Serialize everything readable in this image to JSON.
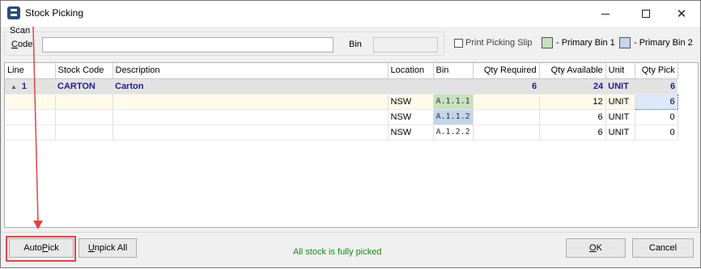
{
  "window": {
    "title": "Stock Picking",
    "controls": [
      "minimize-icon",
      "maximize-icon",
      "close-icon"
    ]
  },
  "scan": {
    "group_label": "Scan",
    "code_label_prefix": "",
    "code_label_accel": "C",
    "code_label_rest": "ode",
    "code_value": "",
    "bin_label": "Bin",
    "bin_value": ""
  },
  "options": {
    "print_picking_slip_label": "Print Picking Slip",
    "print_picking_slip_checked": false,
    "legend": [
      {
        "label": " - Primary Bin 1",
        "color": "#c6e0c0"
      },
      {
        "label": " - Primary Bin 2",
        "color": "#c4d4ea"
      }
    ]
  },
  "grid": {
    "columns": [
      "Line",
      "Stock Code",
      "Description",
      "Location",
      "Bin",
      "Qty Required",
      "Qty Available",
      "Unit",
      "Qty Pick"
    ],
    "group": {
      "expand_icon": "▲",
      "line": "1",
      "stock_code": "CARTON",
      "description": "Carton",
      "location": "",
      "bin": "",
      "qty_required": "6",
      "qty_available": "24",
      "unit": "UNIT",
      "qty_pick": "6"
    },
    "rows": [
      {
        "location": "NSW",
        "bin": "A.1.1.1",
        "qty_required": "",
        "qty_available": "12",
        "unit": "UNIT",
        "qty_pick": "6"
      },
      {
        "location": "NSW",
        "bin": "A.1.1.2",
        "qty_required": "",
        "qty_available": "6",
        "unit": "UNIT",
        "qty_pick": "0"
      },
      {
        "location": "NSW",
        "bin": "A.1.2.2",
        "qty_required": "",
        "qty_available": "6",
        "unit": "UNIT",
        "qty_pick": "0"
      }
    ]
  },
  "footer": {
    "auto_pick_prefix": "Auto ",
    "auto_pick_accel": "P",
    "auto_pick_rest": "ick",
    "unpick_accel": "U",
    "unpick_rest": "npick All",
    "status": "All stock is fully picked",
    "status_color": "#1a8a1a",
    "ok_accel": "O",
    "ok_rest": "K",
    "cancel_label": "Cancel"
  },
  "annotation": {
    "color": "#e04545"
  }
}
